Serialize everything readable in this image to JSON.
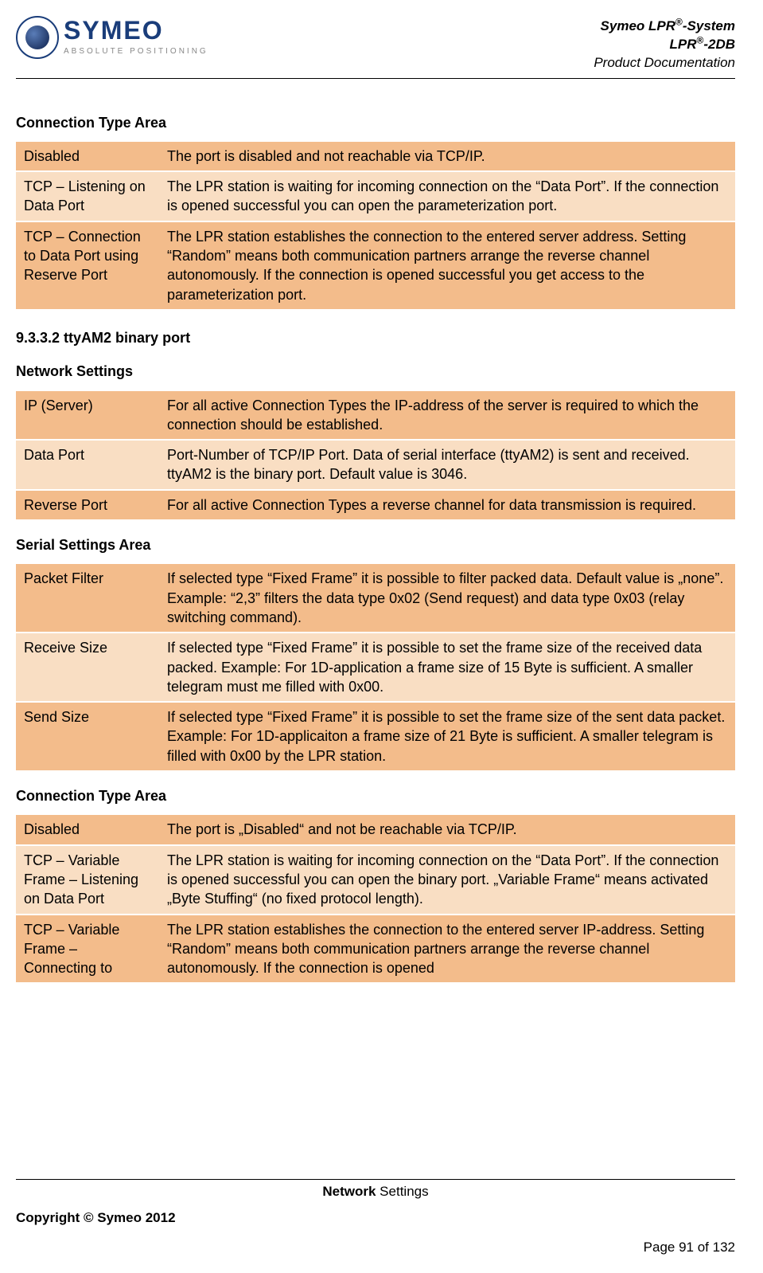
{
  "header": {
    "company_name": "SYMEO",
    "company_tag": "ABSOLUTE POSITIONING",
    "line1_a": "Symeo LPR",
    "line1_b": "-System",
    "line2_a": "LPR",
    "line2_b": "-2DB",
    "line3": "Product Documentation"
  },
  "sections": {
    "conn_type_area": "Connection Type Area",
    "num_heading_9332": "9.3.3.2   ttyAM2 binary port",
    "network_settings": "Network Settings",
    "serial_settings": "Serial Settings Area",
    "conn_type_area_2": "Connection Type Area"
  },
  "table1": {
    "r0": {
      "k": "Disabled",
      "v": "The port is disabled and not reachable via TCP/IP."
    },
    "r1": {
      "k": "TCP – Listening on Data Port",
      "v": "The LPR station is waiting for incoming connection on the “Data Port”. If the connection is opened successful you can open the parameterization port."
    },
    "r2": {
      "k": "TCP – Connection to Data Port using Reserve Port",
      "v": "The LPR station establishes the connection to the entered server address. Setting “Random” means both communication partners arrange the reverse channel autonomously. If the connection is opened successful you get access to the parameterization port."
    }
  },
  "table2": {
    "r0": {
      "k": "IP (Server)",
      "v": "For all active Connection Types the IP-address of the server is required to which the connection should be established."
    },
    "r1": {
      "k": "Data Port",
      "v": "Port-Number of TCP/IP Port. Data of serial interface (ttyAM2) is sent and received. ttyAM2 is the binary port. Default value is 3046."
    },
    "r2": {
      "k": "Reverse Port",
      "v": "For all active Connection Types a reverse channel for data transmission is required."
    }
  },
  "table3": {
    "r0": {
      "k": "Packet Filter",
      "v": "If selected type “Fixed Frame” it is possible to filter packed data. Default value is „none”. Example: “2,3” filters the data type 0x02 (Send request) and data type 0x03 (relay switching command)."
    },
    "r1": {
      "k": "Receive Size",
      "v": "If selected type “Fixed Frame” it is possible to set the frame size of the received data packed. Example: For 1D-application a frame size of 15 Byte is sufficient. A smaller telegram must me filled with 0x00."
    },
    "r2": {
      "k": "Send Size",
      "v": "If selected type “Fixed Frame” it is possible to set the frame size of the sent data packet. Example: For 1D-applicaiton a frame size of 21 Byte is sufficient. A smaller telegram is filled with 0x00 by the LPR station."
    }
  },
  "table4": {
    "r0": {
      "k": "Disabled",
      "v": "The port is „Disabled“ and not be reachable via TCP/IP."
    },
    "r1": {
      "k": "TCP – Variable Frame – Listening on Data Port",
      "v": "The LPR station is waiting for incoming connection on the “Data Port”. If the connection is opened successful you can open the binary port. „Variable Frame“ means activated „Byte Stuffing“ (no fixed protocol length)."
    },
    "r2": {
      "k": "TCP – Variable Frame – Connecting to",
      "v": "The LPR station establishes the connection to the entered server IP-address. Setting “Random” means both communication partners arrange the reverse channel autonomously. If the connection is opened"
    }
  },
  "footer": {
    "center_bold": "Network",
    "center_rest": " Settings",
    "left": "Copyright © Symeo 2012",
    "right": "Page 91 of 132"
  }
}
